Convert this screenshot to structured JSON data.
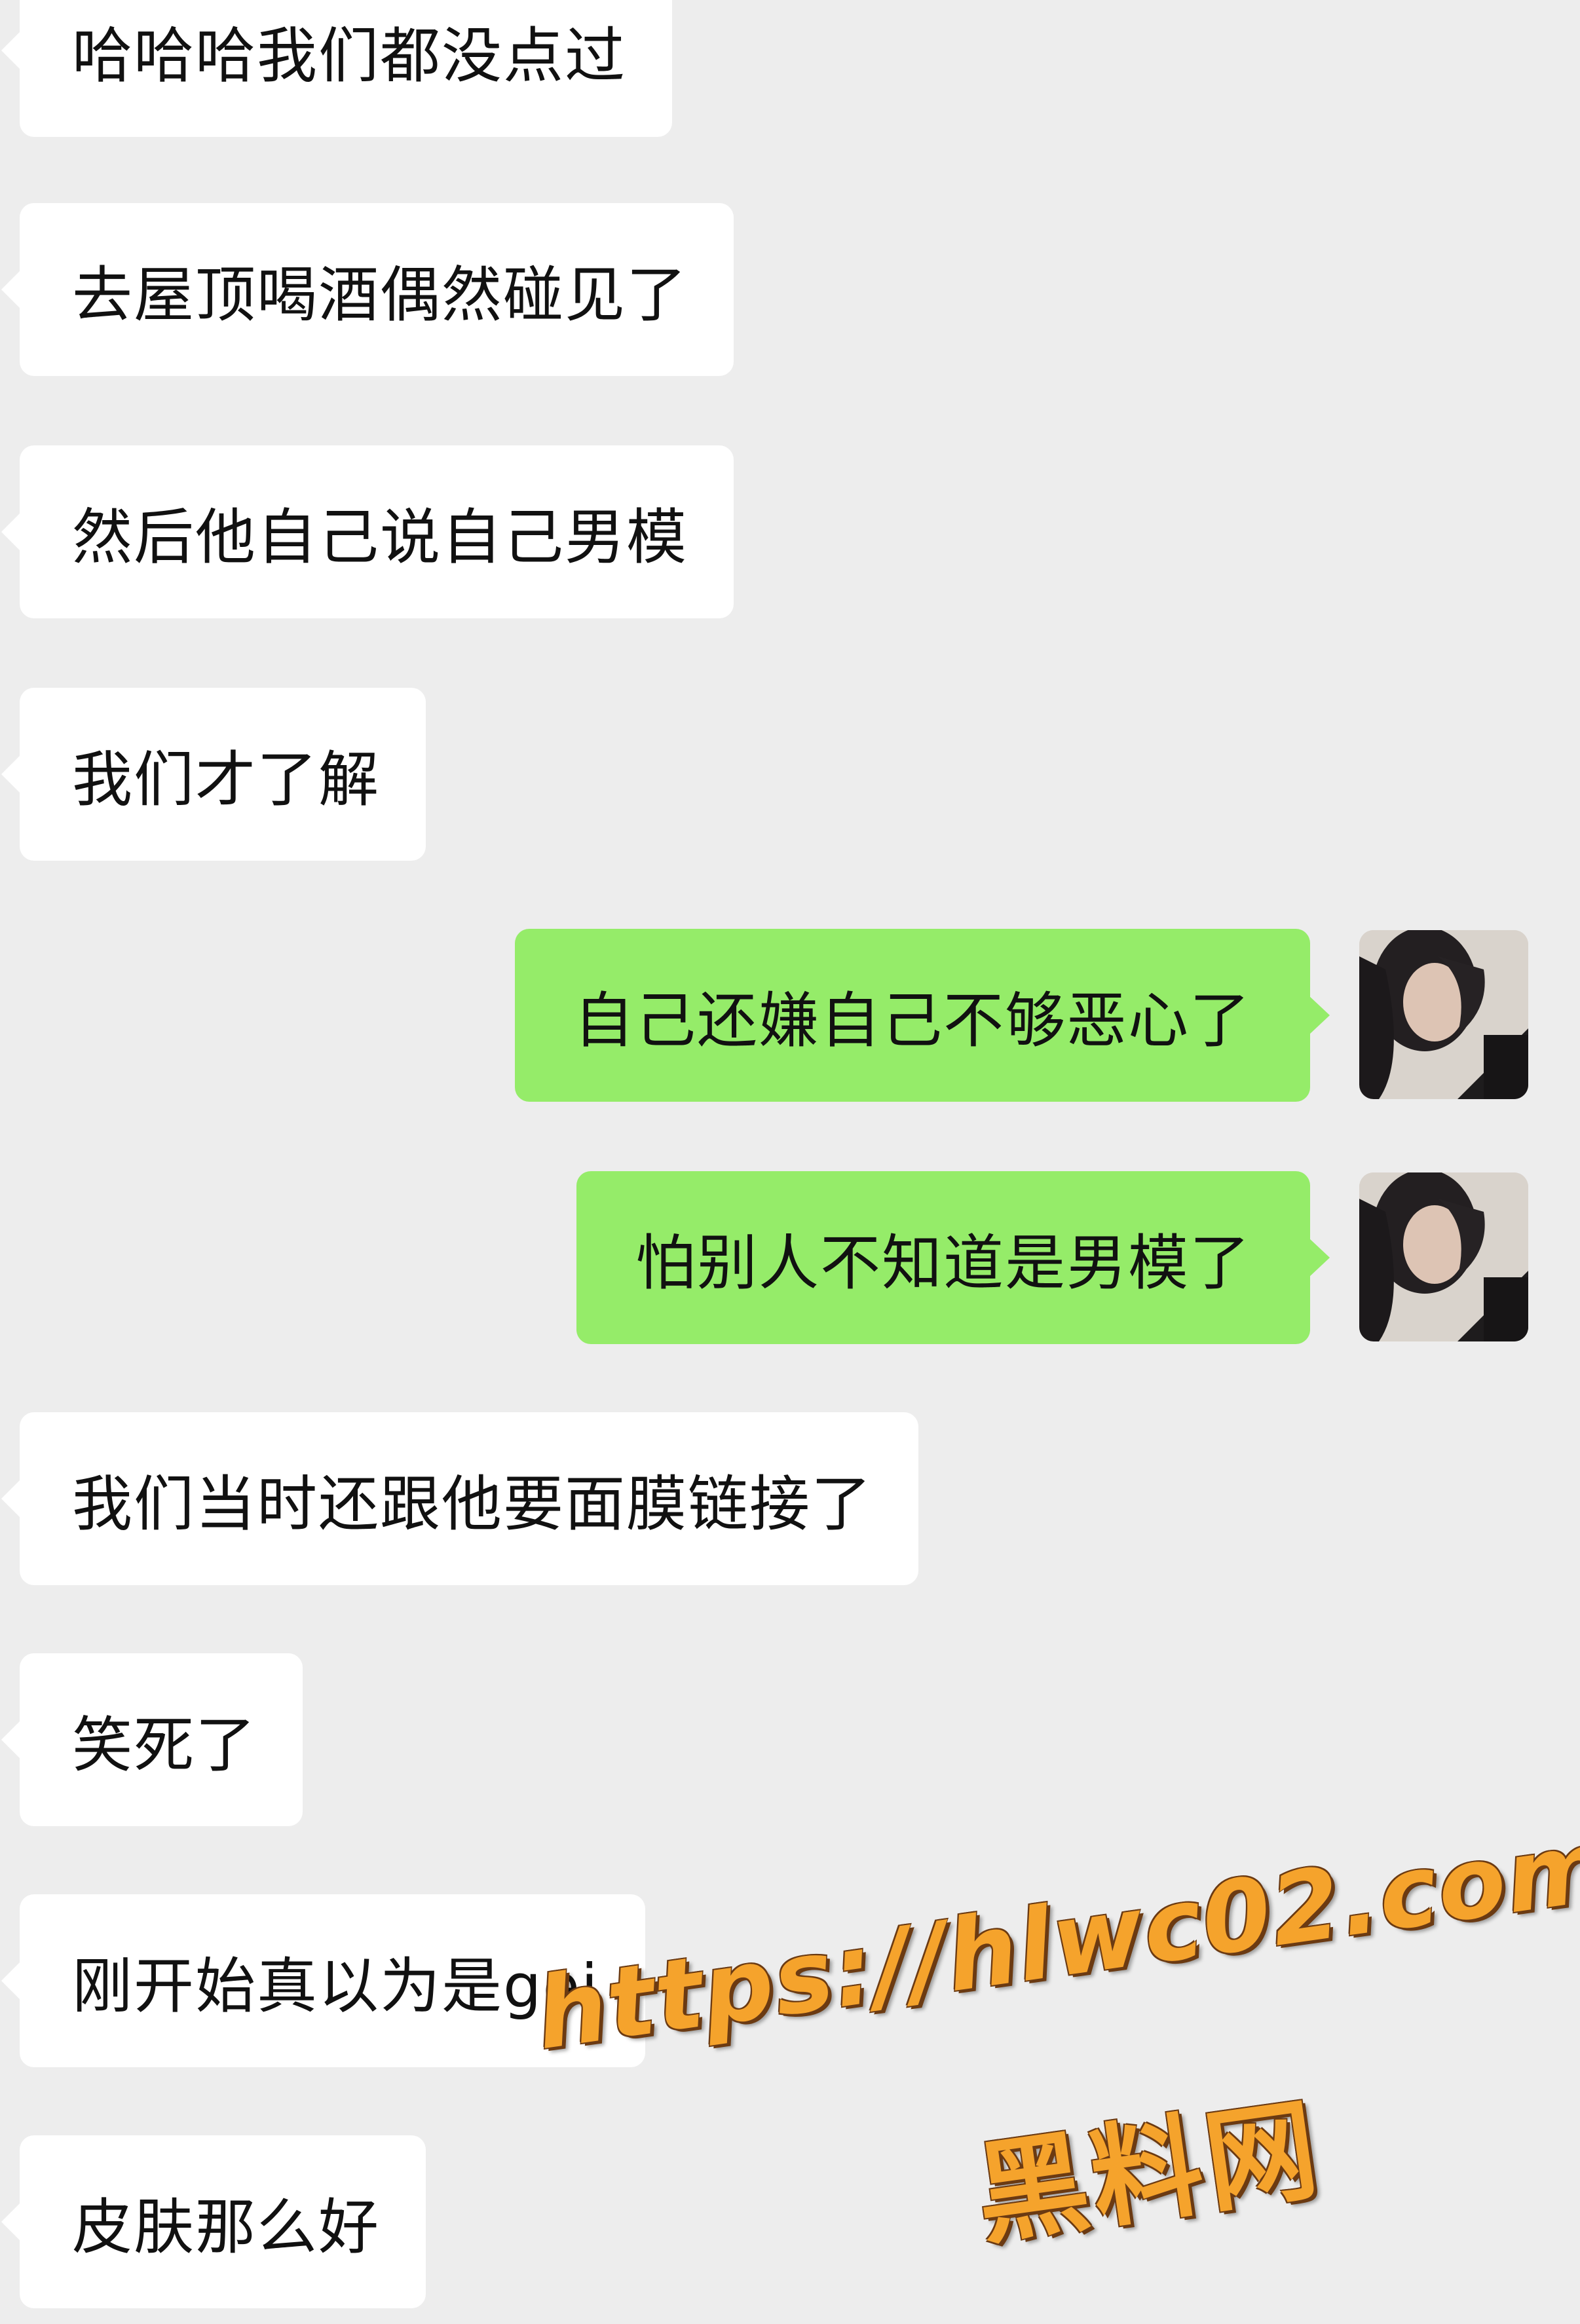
{
  "messages": [
    {
      "side": "left",
      "text": "哈哈哈我们都没点过"
    },
    {
      "side": "left",
      "text": "去屋顶喝酒偶然碰见了"
    },
    {
      "side": "left",
      "text": "然后他自己说自己男模"
    },
    {
      "side": "left",
      "text": "我们才了解"
    },
    {
      "side": "right",
      "text": "自己还嫌自己不够恶心了"
    },
    {
      "side": "right",
      "text": "怕别人不知道是男模了"
    },
    {
      "side": "left",
      "text": "我们当时还跟他要面膜链接了"
    },
    {
      "side": "left",
      "text": "笑死了"
    },
    {
      "side": "left",
      "text": "刚开始真以为是gei"
    },
    {
      "side": "left",
      "text": "皮肤那么好"
    }
  ],
  "watermark": {
    "url": "https://hlwc02.com",
    "name": "黑料网"
  },
  "colors": {
    "background": "#ededed",
    "left_bubble": "#ffffff",
    "right_bubble": "#95ec69",
    "watermark": "#f5a32c"
  },
  "icons": {
    "avatar": "user-avatar-photo"
  }
}
